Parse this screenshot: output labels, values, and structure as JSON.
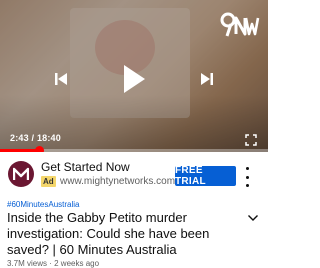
{
  "player": {
    "channel_logo_text": "9NW",
    "current_time": "2:43",
    "separator": " / ",
    "duration": "18:40",
    "progress_fraction": 0.145,
    "accent_color": "#ff0000",
    "icons": {
      "prev": "skip-previous-icon",
      "play": "play-icon",
      "next": "skip-next-icon",
      "fullscreen": "fullscreen-icon"
    }
  },
  "ad": {
    "title": "Get Started Now",
    "badge": "Ad",
    "url": "www.mightynetworks.com",
    "cta": "FREE TRIAL",
    "avatar_icon": "mighty-networks-logo-icon",
    "cta_color": "#065fd4"
  },
  "video": {
    "hashtag": "#60MinutesAustralia",
    "title": "Inside the Gabby Petito murder investigation: Could she have been saved? | 60 Minutes Australia",
    "views": "3.7M views",
    "dot": " · ",
    "age": "2 weeks ago"
  }
}
